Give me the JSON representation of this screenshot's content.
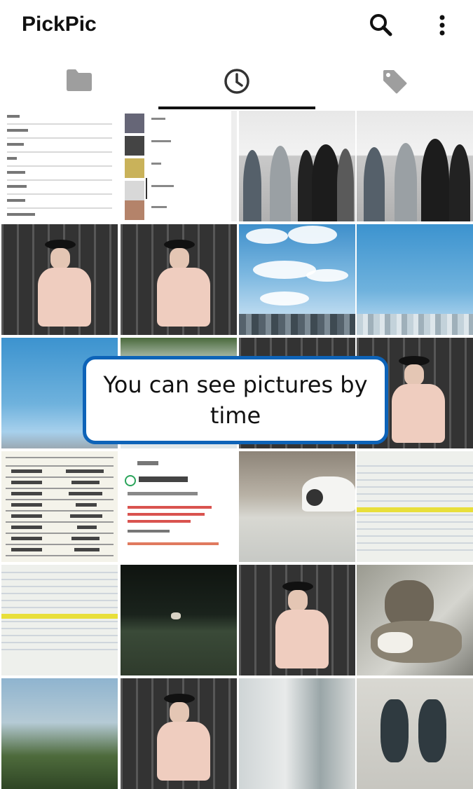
{
  "app": {
    "title": "PickPic"
  },
  "appbar": {
    "search_icon": "search-icon",
    "more_icon": "more-vert-icon"
  },
  "tabs": [
    {
      "id": "folder",
      "icon": "folder-icon",
      "selected": false
    },
    {
      "id": "time",
      "icon": "clock-icon",
      "selected": true
    },
    {
      "id": "tag",
      "icon": "tag-icon",
      "selected": false
    }
  ],
  "tooltip": {
    "text": "You can see pictures by time"
  },
  "colors": {
    "tooltip_border": "#0d63b8",
    "indicator": "#111111",
    "icon_inactive": "#9e9e9e",
    "icon_active": "#333333"
  }
}
